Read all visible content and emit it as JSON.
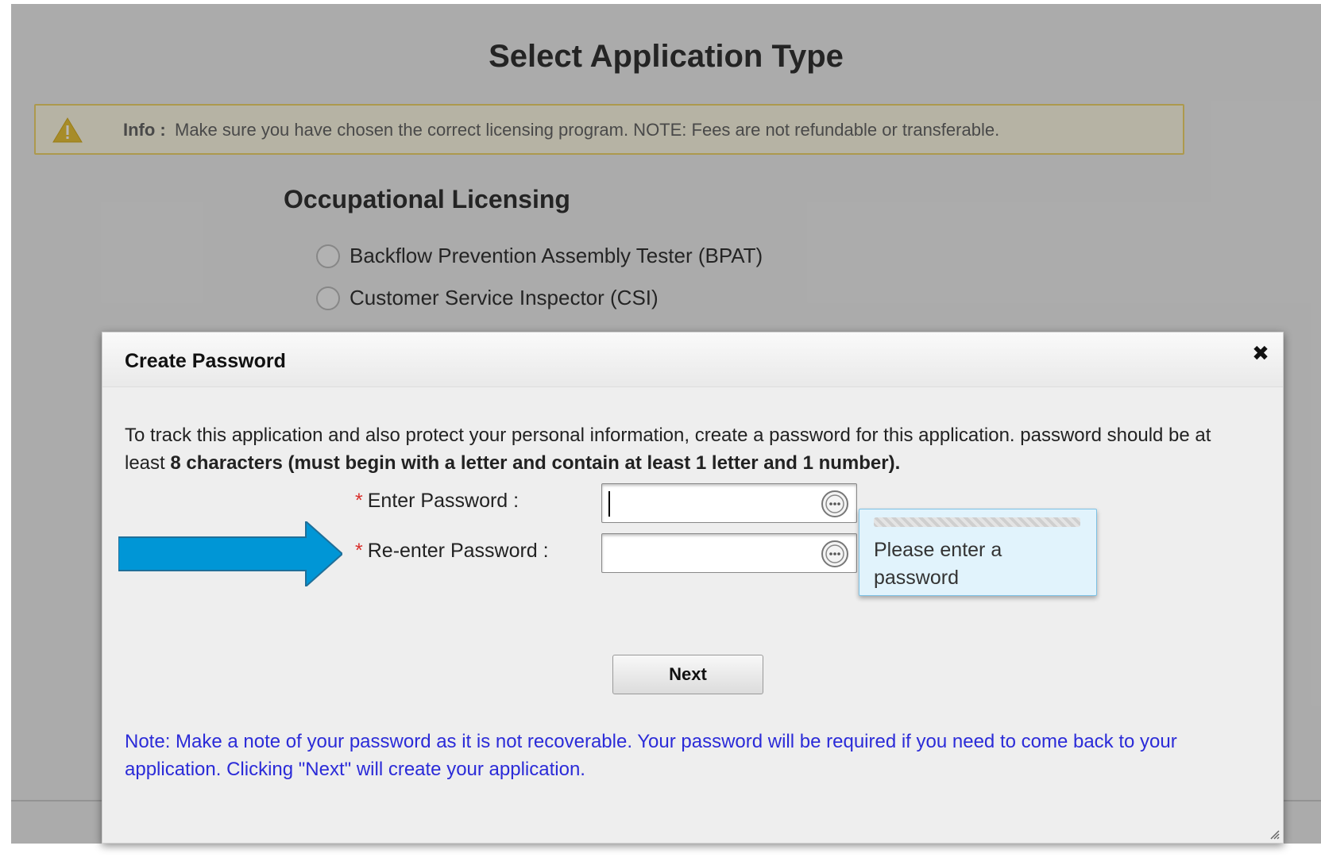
{
  "page": {
    "title": "Select Application Type",
    "info": {
      "label": "Info :",
      "text": "Make sure you have chosen the correct licensing program. NOTE: Fees are not refundable or transferable."
    },
    "section_title": "Occupational Licensing",
    "options": [
      {
        "label": "Backflow Prevention Assembly Tester (BPAT)"
      },
      {
        "label": "Customer Service Inspector (CSI)"
      }
    ]
  },
  "dialog": {
    "title": "Create Password",
    "close_glyph": "✖",
    "intro_plain": "To track this application and also protect your personal information, create a password for this application. password should be at least ",
    "intro_bold": "8 characters (must begin with a letter and contain at least 1 letter and 1 number).",
    "required_marker": "*",
    "enter_label": "Enter Password :",
    "reenter_label": "Re-enter Password :",
    "enter_value": "",
    "reenter_value": "",
    "tooltip_text": "Please enter a password",
    "next_label": "Next",
    "note": "Note: Make a note of your password as it is not recoverable. Your password will be required if you need to come back to your application. Clicking \"Next\" will create your application."
  },
  "colors": {
    "arrow": "#0096d6",
    "note_text": "#2b2bd8",
    "required": "#d9302c",
    "tooltip_bg": "#e1f3fc"
  },
  "icons": {
    "info": "warning-triangle-icon",
    "reveal": "password-reveal-icon",
    "close": "close-icon",
    "annotation": "arrow-right-icon"
  }
}
